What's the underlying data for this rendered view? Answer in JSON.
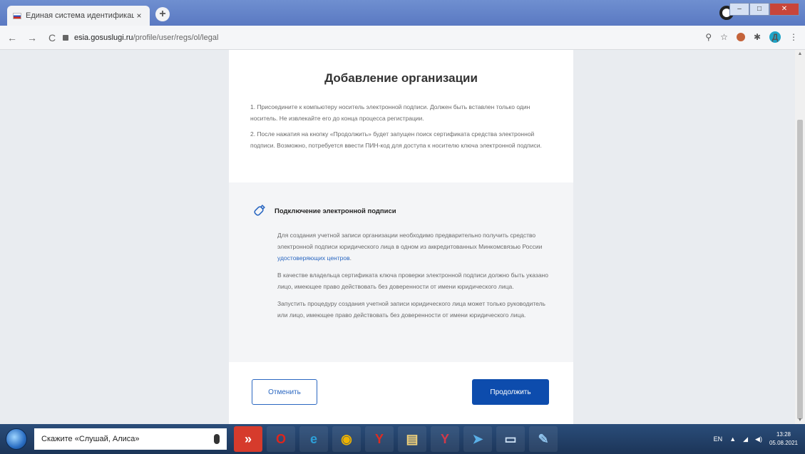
{
  "browser": {
    "tab_title": "Единая система идентификац",
    "tab_close": "×",
    "new_tab": "+",
    "url_host": "esia.gosuslugi.ru",
    "url_path": "/profile/user/regs/ol/legal",
    "avatar_letter": "Д"
  },
  "page": {
    "title": "Добавление организации",
    "steps": [
      "1. Присоедините к компьютеру носитель электронной подписи. Должен быть вставлен только один носитель. Не извлекайте его до конца процесса регистрации.",
      "2. После нажатия на кнопку «Продолжить» будет запущен поиск сертификата средства электронной подписи. Возможно, потребуется ввести ПИН-код для доступа к носителю ключа электронной подписи."
    ],
    "info": {
      "title": "Подключение электронной подписи",
      "para1_text": "Для создания учетной записи организации необходимо предварительно получить средство электронной подписи юридического лица в одном из аккредитованных Минкомсвязью России ",
      "para1_link": "удостоверяющих центров",
      "para1_end": ".",
      "para2": "В качестве владельца сертификата ключа проверки электронной подписи должно быть указано лицо, имеющее право действовать без доверенности от имени юридического лица.",
      "para3": "Запустить процедуру создания учетной записи юридического лица может только руководитель или лицо, имеющее право действовать без доверенности от имени юридического лица."
    },
    "cancel_label": "Отменить",
    "continue_label": "Продолжить"
  },
  "taskbar": {
    "search_text": "Скажите «Слушай, Алиса»",
    "lang": "EN",
    "time": "13:28",
    "date": "05.08.2021"
  },
  "colors": {
    "primary": "#0d4cad",
    "link": "#2a67c1"
  }
}
